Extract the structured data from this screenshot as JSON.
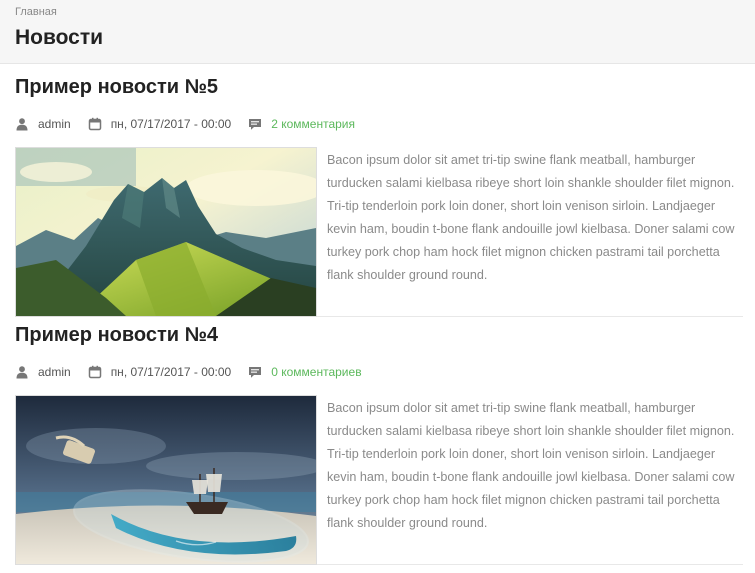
{
  "breadcrumb": "Главная",
  "page_title": "Новости",
  "news": [
    {
      "title": "Пример новости №5",
      "author": "admin",
      "date": "пн, 07/17/2017 - 00:00",
      "comments": "2 комментария",
      "image": "mountain-landscape",
      "excerpt": "Bacon ipsum dolor sit amet tri-tip swine flank meatball, hamburger turducken salami kielbasa ribeye short loin shankle shoulder filet mignon. Tri-tip tenderloin pork loin doner, short loin venison sirloin. Landjaeger kevin ham, boudin t-bone flank andouille jowl kielbasa. Doner salami cow turkey pork chop ham hock filet mignon chicken pastrami tail porchetta flank shoulder ground round."
    },
    {
      "title": "Пример новости №4",
      "author": "admin",
      "date": "пн, 07/17/2017 - 00:00",
      "comments": "0 комментариев",
      "image": "ship-in-bottle",
      "excerpt": "Bacon ipsum dolor sit amet tri-tip swine flank meatball, hamburger turducken salami kielbasa ribeye short loin shankle shoulder filet mignon. Tri-tip tenderloin pork loin doner, short loin venison sirloin. Landjaeger kevin ham, boudin t-bone flank andouille jowl kielbasa. Doner salami cow turkey pork chop ham hock filet mignon chicken pastrami tail porchetta flank shoulder ground round."
    }
  ],
  "icons": {
    "author": "user-icon",
    "date": "calendar-icon",
    "comments": "comment-icon"
  },
  "colors": {
    "accent": "#5cb85c",
    "header_bg": "#f6f6f6",
    "excerpt_text": "#8a8a8a"
  }
}
